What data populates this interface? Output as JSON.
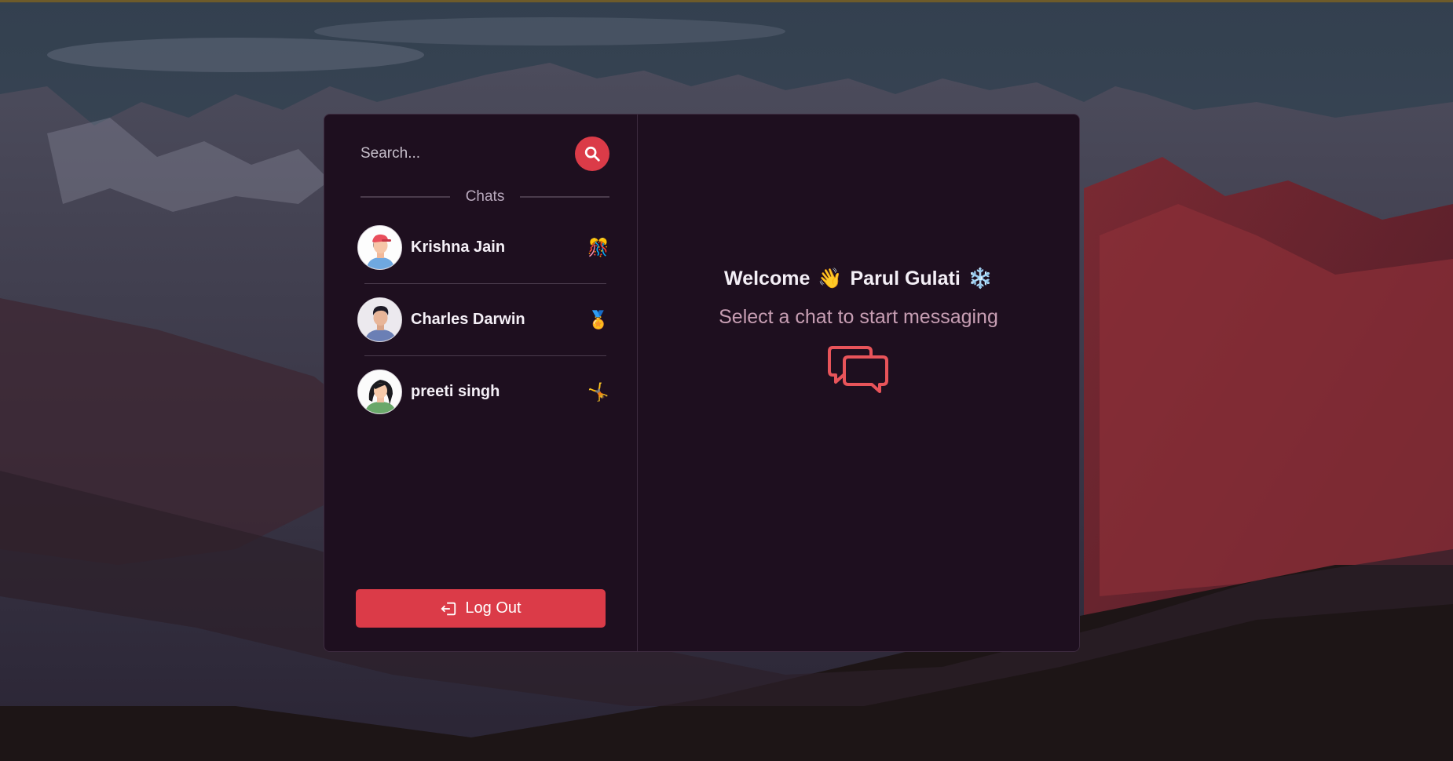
{
  "search": {
    "placeholder": "Search..."
  },
  "sidebar": {
    "section_label": "Chats",
    "chats": [
      {
        "name": "Krishna Jain",
        "emoji": "🎊",
        "avatar": "avatar-man-cap-icon"
      },
      {
        "name": "Charles Darwin",
        "emoji": "🏅",
        "avatar": "avatar-man-icon"
      },
      {
        "name": "preeti singh",
        "emoji": "🤸",
        "avatar": "avatar-woman-icon"
      }
    ],
    "logout_label": "Log Out"
  },
  "main": {
    "welcome_word": "Welcome",
    "wave_emoji": "👋",
    "user_name": "Parul Gulati",
    "snow_emoji": "❄️",
    "subtitle": "Select a chat to start messaging"
  },
  "colors": {
    "accent": "#db3b48",
    "card_bg": "#1e0f1f",
    "subtitle": "#c79eb3"
  }
}
